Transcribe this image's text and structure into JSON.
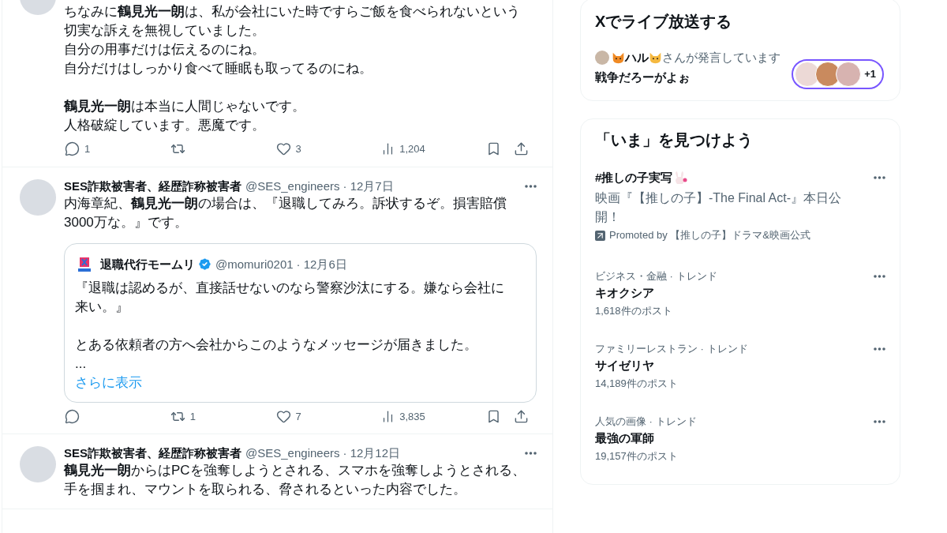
{
  "timeline": [
    {
      "body": [
        [
          "ちなみに**鶴見光一朗**は、私が会社にいた時ですらご飯を食べられないという",
          "切実な訴えを無視していました。",
          "自分の用事だけは伝えるのにね。",
          "自分だけはしっかり食べて睡眠も取ってるのにね。"
        ],
        [
          "**鶴見光一朗**は本当に人間じゃないです。",
          "人格破綻しています。悪魔です。"
        ]
      ],
      "actions": [
        {
          "kind": "reply",
          "count": "1"
        },
        {
          "kind": "repost"
        },
        {
          "kind": "like",
          "count": "3"
        },
        {
          "kind": "views",
          "count": "1,204"
        }
      ]
    },
    {
      "author": "SES詐欺被害者、経歴詐称被害者",
      "handle": "@SES_engineers",
      "date": "· 12月7日",
      "body": [
        [
          "内海章紀、**鶴見光一朗**の場合は、『退職してみろ。訴状するぞ。損害賠償",
          "3000万な。』です。"
        ]
      ],
      "quote": {
        "author": "退職代行モームリ",
        "verified": true,
        "handle": "@momuri0201",
        "date": "· 12月6日",
        "body": [
          [
            "『退職は認めるが、直接話せないのなら警察沙汰にする。嫌なら会社に",
            "来い。』"
          ],
          [
            "とある依頼者の方へ会社からこのようなメッセージが届きました。",
            "..."
          ]
        ],
        "more": "さらに表示"
      },
      "actions": [
        {
          "kind": "reply"
        },
        {
          "kind": "repost",
          "count": "1"
        },
        {
          "kind": "like",
          "count": "7"
        },
        {
          "kind": "views",
          "count": "3,835"
        }
      ]
    },
    {
      "author": "SES詐欺被害者、経歴詐称被害者",
      "handle": "@SES_engineers",
      "date": "· 12月12日",
      "body": [
        [
          "**鶴見光一朗**からはPCを強奪しようとされる、スマホを強奪しようとされる、",
          "手を掴まれ、マウントを取られる、脅されるといった内容でした。"
        ]
      ]
    }
  ],
  "live": {
    "title": "Xでライブ放送する",
    "speaker": "ハル",
    "speaking": "さんが発言しています",
    "topic": "戦争だろーがよぉ",
    "listeners_more": "+1"
  },
  "trends": {
    "title": "「いま」を見つけよう",
    "items": [
      {
        "kind": "promoted",
        "name": "#推しの子実写",
        "description": "映画『【推しの子】-The Final Act-』本日公開！",
        "promoted_by": "Promoted by 【推しの子】ドラマ&映画公式"
      },
      {
        "kind": "trend",
        "context": "ビジネス・金融 · トレンド",
        "name": "キオクシア",
        "posts": "1,618件のポスト"
      },
      {
        "kind": "trend",
        "context": "ファミリーレストラン · トレンド",
        "name": "サイゼリヤ",
        "posts": "14,189件のポスト"
      },
      {
        "kind": "trend",
        "context": "人気の画像 · トレンド",
        "name": "最強の軍師",
        "posts": "19,157件のポスト"
      }
    ]
  }
}
